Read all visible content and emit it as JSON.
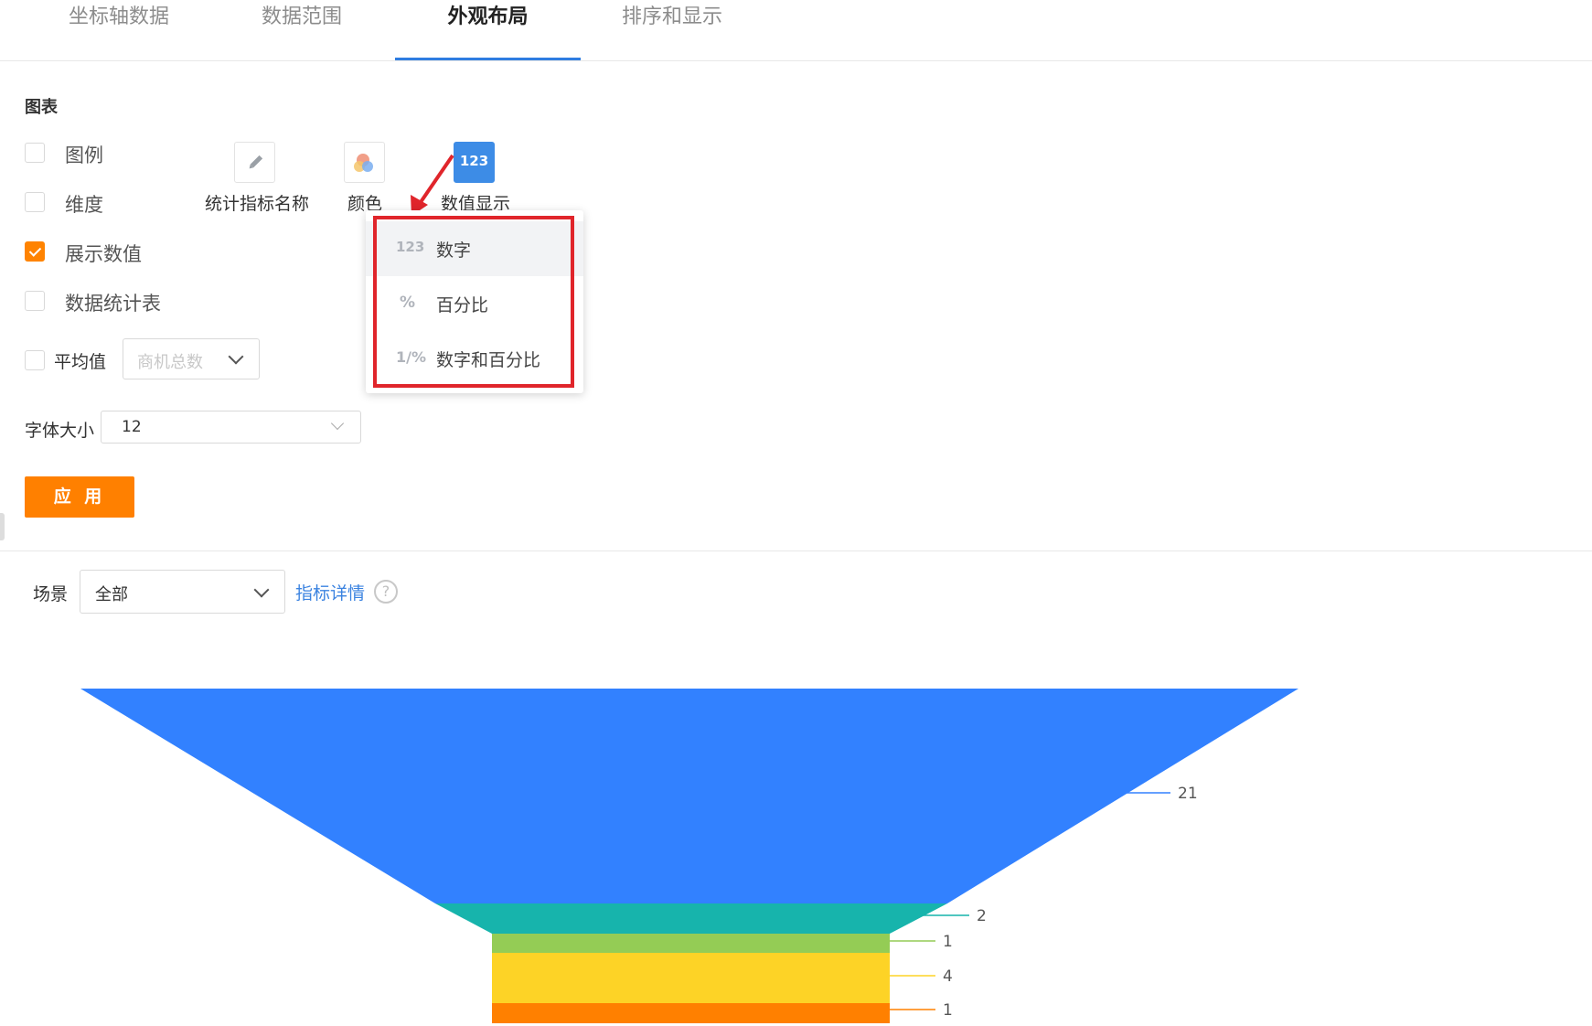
{
  "tabs": [
    {
      "label": "坐标轴数据",
      "active": false
    },
    {
      "label": "数据范围",
      "active": false
    },
    {
      "label": "外观布局",
      "active": true
    },
    {
      "label": "排序和显示",
      "active": false
    }
  ],
  "section_title": "图表",
  "checkboxes": {
    "legend": {
      "label": "图例",
      "checked": false
    },
    "dimension": {
      "label": "维度",
      "checked": false
    },
    "show_values": {
      "label": "展示数值",
      "checked": true
    },
    "stats_table": {
      "label": "数据统计表",
      "checked": false
    }
  },
  "tools": {
    "metric_name": {
      "label": "统计指标名称",
      "icon": "pencil-icon"
    },
    "color": {
      "label": "颜色",
      "icon": "palette-icon"
    },
    "value_display": {
      "label": "数值显示",
      "icon_text": "123",
      "active": true
    }
  },
  "value_display_menu": [
    {
      "icon": "123",
      "label": "数字",
      "highlighted": true
    },
    {
      "icon": "%",
      "label": "百分比",
      "highlighted": false
    },
    {
      "icon": "1/%",
      "label": "数字和百分比",
      "highlighted": false
    }
  ],
  "average": {
    "label": "平均值",
    "checked": false,
    "select_placeholder": "商机总数"
  },
  "font_size": {
    "label": "字体大小",
    "value": "12"
  },
  "apply_label": "应 用",
  "scene": {
    "label": "场景",
    "value": "全部"
  },
  "metric_detail_link": "指标详情",
  "help_icon_glyph": "?",
  "accent_colors": {
    "tab_active": "#2f7de1",
    "primary_button": "#ff8000",
    "annotation": "#e0252b",
    "link": "#3b83e0"
  },
  "chart_data": {
    "type": "funnel",
    "values": [
      21,
      2,
      1,
      4,
      1
    ],
    "colors": [
      "#3281ff",
      "#17b4ac",
      "#94cc55",
      "#fdd326",
      "#ff8000"
    ]
  }
}
